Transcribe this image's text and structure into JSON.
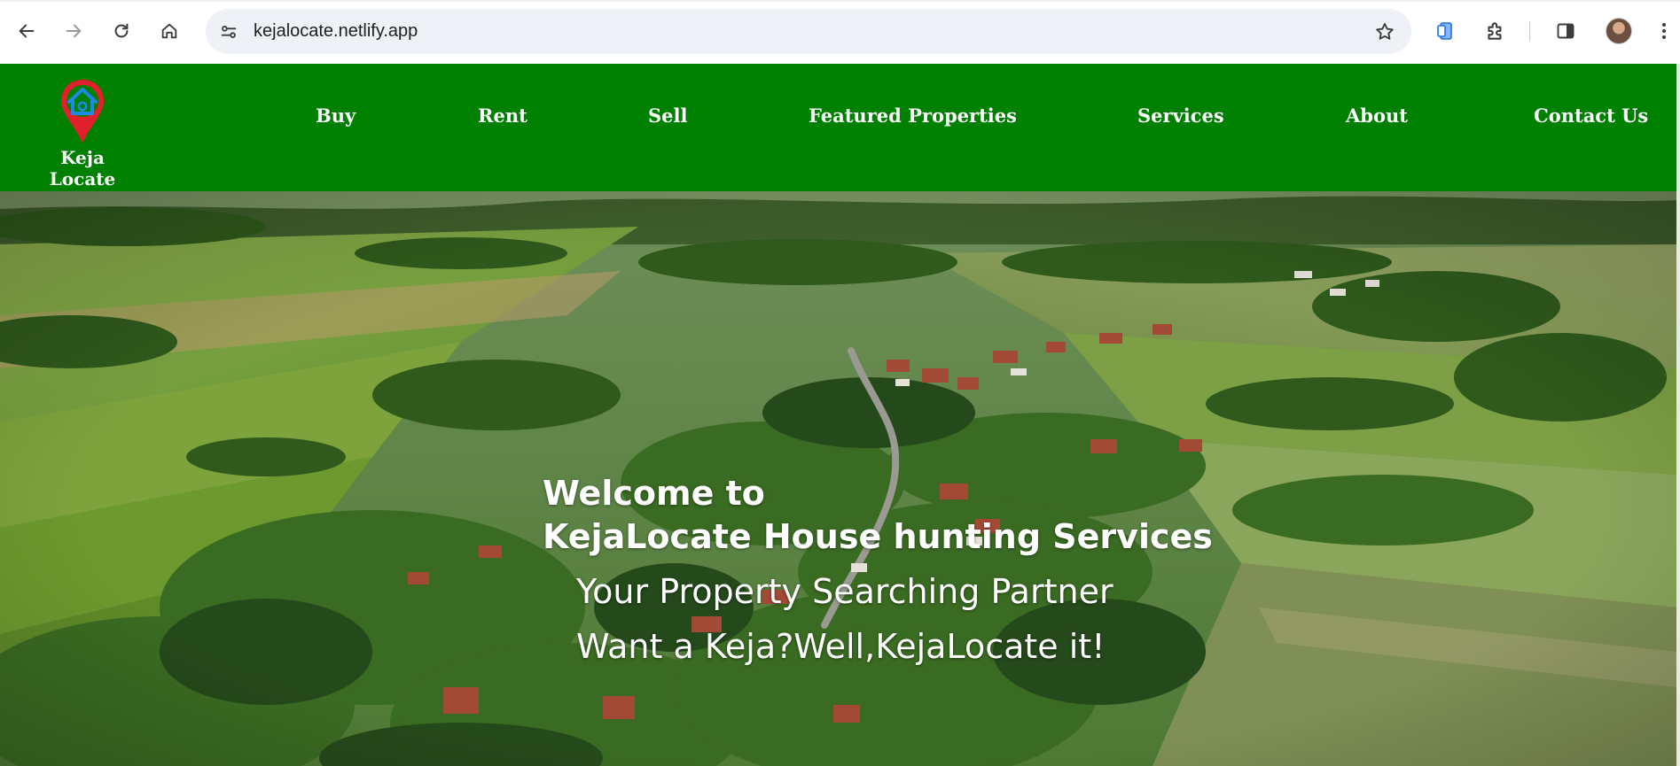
{
  "browser": {
    "url": "kejalocate.netlify.app",
    "icons": {
      "back": "arrow-left-icon",
      "forward": "arrow-right-icon",
      "reload": "reload-icon",
      "home": "home-icon",
      "site_info": "tune-icon",
      "bookmark": "star-icon",
      "extension_blue": "puzzle-app-icon",
      "extensions": "puzzle-icon",
      "side_panel": "side-panel-icon",
      "profile": "avatar",
      "menu": "kebab-menu-icon"
    }
  },
  "site": {
    "brand": "Keja Locate",
    "colors": {
      "header": "#008000",
      "text": "#ffffff",
      "logo_pin": "#e0202a",
      "logo_house": "#1e88e5"
    },
    "nav": [
      "Buy",
      "Rent",
      "Sell",
      "Featured Properties",
      "Services",
      "About",
      "Contact Us"
    ]
  },
  "hero": {
    "welcome_line1": "Welcome to",
    "welcome_line2": "KejaLocate House hunting Services",
    "tagline1": "Your Property Searching Partner",
    "tagline2": "Want a Keja?Well,KejaLocate it!"
  }
}
